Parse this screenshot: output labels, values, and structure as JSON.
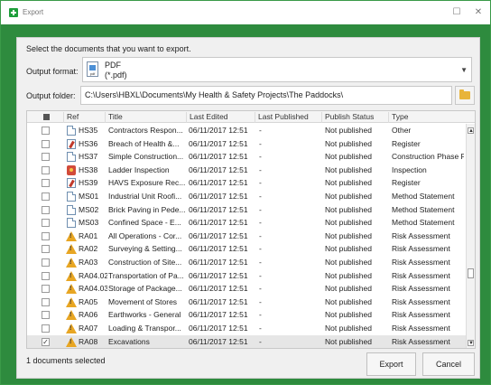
{
  "window": {
    "title": "Export",
    "minimize": "☐",
    "close": "✕"
  },
  "dialog": {
    "instruction": "Select the documents that you want to export.",
    "output_format_label": "Output format:",
    "format_name": "PDF",
    "format_ext": "(*.pdf)",
    "format_icon_text": "pdf",
    "output_folder_label": "Output folder:",
    "output_folder_value": "C:\\Users\\HBXL\\Documents\\My Health & Safety Projects\\The Paddocks\\",
    "columns": [
      "Ref",
      "Title",
      "Last Edited",
      "Last Published",
      "Publish Status",
      "Type"
    ],
    "rows": [
      {
        "icon": "doc",
        "checked": "",
        "ref": "HS35",
        "title": "Contractors Respon...",
        "edited": "06/11/2017 12:51",
        "published": "-",
        "status": "Not published",
        "type": "Other"
      },
      {
        "icon": "reg",
        "checked": "",
        "ref": "HS36",
        "title": "Breach of Health &...",
        "edited": "06/11/2017 12:51",
        "published": "-",
        "status": "Not published",
        "type": "Register"
      },
      {
        "icon": "doc",
        "checked": "",
        "ref": "HS37",
        "title": "Simple Construction...",
        "edited": "06/11/2017 12:51",
        "published": "-",
        "status": "Not published",
        "type": "Construction Phase Pla"
      },
      {
        "icon": "insp",
        "checked": "",
        "ref": "HS38",
        "title": "Ladder Inspection",
        "edited": "06/11/2017 12:51",
        "published": "-",
        "status": "Not published",
        "type": "Inspection"
      },
      {
        "icon": "reg",
        "checked": "",
        "ref": "HS39",
        "title": "HAVS Exposure Rec...",
        "edited": "06/11/2017 12:51",
        "published": "-",
        "status": "Not published",
        "type": "Register"
      },
      {
        "icon": "doc",
        "checked": "",
        "ref": "MS01",
        "title": "Industrial Unit Roofi...",
        "edited": "06/11/2017 12:51",
        "published": "-",
        "status": "Not published",
        "type": "Method Statement"
      },
      {
        "icon": "doc",
        "checked": "",
        "ref": "MS02",
        "title": "Brick Paving in Pede...",
        "edited": "06/11/2017 12:51",
        "published": "-",
        "status": "Not published",
        "type": "Method Statement"
      },
      {
        "icon": "doc",
        "checked": "",
        "ref": "MS03",
        "title": "Confined Space - E...",
        "edited": "06/11/2017 12:51",
        "published": "-",
        "status": "Not published",
        "type": "Method Statement"
      },
      {
        "icon": "warn",
        "checked": "",
        "ref": "RA01",
        "title": "All Operations - Cor...",
        "edited": "06/11/2017 12:51",
        "published": "-",
        "status": "Not published",
        "type": "Risk Assessment"
      },
      {
        "icon": "warn",
        "checked": "",
        "ref": "RA02",
        "title": "Surveying & Setting...",
        "edited": "06/11/2017 12:51",
        "published": "-",
        "status": "Not published",
        "type": "Risk Assessment"
      },
      {
        "icon": "warn",
        "checked": "",
        "ref": "RA03",
        "title": "Construction of Site...",
        "edited": "06/11/2017 12:51",
        "published": "-",
        "status": "Not published",
        "type": "Risk Assessment"
      },
      {
        "icon": "warn",
        "checked": "",
        "ref": "RA04.02",
        "title": "Transportation of Pa...",
        "edited": "06/11/2017 12:51",
        "published": "-",
        "status": "Not published",
        "type": "Risk Assessment"
      },
      {
        "icon": "warn",
        "checked": "",
        "ref": "RA04.03",
        "title": "Storage of Package...",
        "edited": "06/11/2017 12:51",
        "published": "-",
        "status": "Not published",
        "type": "Risk Assessment"
      },
      {
        "icon": "warn",
        "checked": "",
        "ref": "RA05",
        "title": "Movement of Stores",
        "edited": "06/11/2017 12:51",
        "published": "-",
        "status": "Not published",
        "type": "Risk Assessment"
      },
      {
        "icon": "warn",
        "checked": "",
        "ref": "RA06",
        "title": "Earthworks - General",
        "edited": "06/11/2017 12:51",
        "published": "-",
        "status": "Not published",
        "type": "Risk Assessment"
      },
      {
        "icon": "warn",
        "checked": "",
        "ref": "RA07",
        "title": "Loading & Transpor...",
        "edited": "06/11/2017 12:51",
        "published": "-",
        "status": "Not published",
        "type": "Risk Assessment"
      },
      {
        "icon": "warn",
        "checked": "✓",
        "ref": "RA08",
        "title": "Excavations",
        "edited": "06/11/2017 12:51",
        "published": "-",
        "status": "Not published",
        "type": "Risk Assessment"
      }
    ],
    "selected_count": "1 documents selected",
    "export_label": "Export",
    "cancel_label": "Cancel",
    "scroll_up": "▲",
    "scroll_down": "▼",
    "dropdown_arrow": "▼"
  }
}
